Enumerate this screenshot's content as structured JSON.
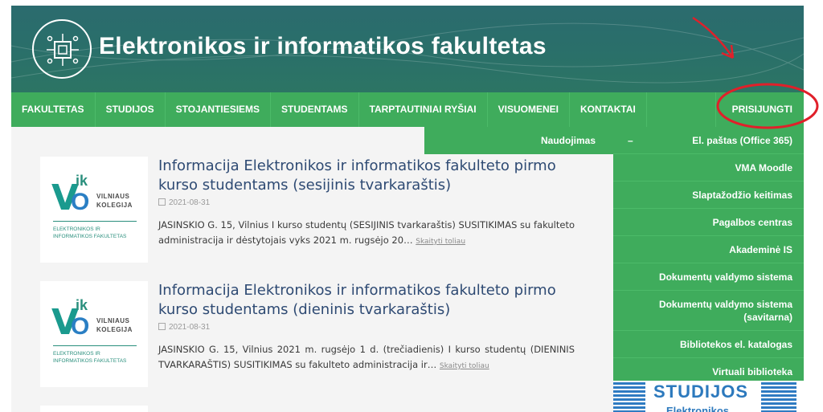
{
  "header": {
    "title": "Elektronikos ir informatikos fakultetas"
  },
  "nav": {
    "items": [
      "FAKULTETAS",
      "STUDIJOS",
      "STOJANTIESIEMS",
      "STUDENTAMS",
      "TARPTAUTINIAI RYŠIAI",
      "VISUOMENEI",
      "KONTAKTAI"
    ],
    "login": "PRISIJUNGTI"
  },
  "submenu": {
    "left_label": "Naudojimas",
    "dash": "–",
    "items": [
      "El. paštas (Office 365)",
      "VMA Moodle",
      "Slaptažodžio keitimas",
      "Pagalbos centras",
      "Akademinė IS",
      "Dokumentų valdymo sistema",
      "Dokumentų valdymo sistema (savitarna)",
      "Bibliotekos el. katalogas",
      "Virtuali biblioteka"
    ]
  },
  "logo": {
    "v": "V",
    "ik": "ik",
    "o": "O",
    "name_line1": "VILNIAUS",
    "name_line2": "KOLEGIJA",
    "faculty_line1": "ELEKTRONIKOS IR",
    "faculty_line2": "INFORMATIKOS FAKULTETAS"
  },
  "posts": [
    {
      "title": "Informacija Elektronikos ir informatikos fakulteto pirmo kurso studentams (sesijinis tvarkaraštis)",
      "date": "2021-08-31",
      "excerpt": "JASINSKIO G. 15, Vilnius I kurso studentų (SESIJINIS tvarkaraštis) SUSITIKIMAS su fakulteto administracija ir dėstytojais vyks 2021 m. rugsėjo 20…",
      "read_more": "Skaityti toliau"
    },
    {
      "title": "Informacija Elektronikos ir informatikos fakulteto pirmo kurso studentams (dieninis tvarkaraštis)",
      "date": "2021-08-31",
      "excerpt": "JASINSKIO G. 15, Vilnius 2021 m. rugsėjo 1 d. (trečiadienis) I kurso studentų (DIENINIS TVARKARAŠTIS) SUSITIKIMAS su fakulteto administracija ir…",
      "read_more": "Skaityti toliau"
    }
  ],
  "banner": {
    "word": "STUDIJOS",
    "sub": "Elektronikos"
  },
  "colors": {
    "header": "#2b6b6e",
    "nav": "#3fac5c",
    "title_text": "#2e4a73",
    "annotation": "#e0202a"
  }
}
